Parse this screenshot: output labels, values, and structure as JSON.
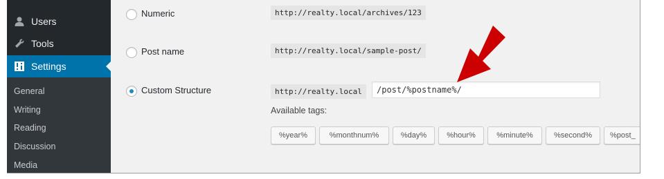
{
  "sidebar": {
    "items": [
      {
        "label": "Users",
        "icon": "user-icon"
      },
      {
        "label": "Tools",
        "icon": "wrench-icon"
      },
      {
        "label": "Settings",
        "icon": "settings-icon",
        "current": true
      }
    ],
    "submenu": [
      "General",
      "Writing",
      "Reading",
      "Discussion",
      "Media"
    ]
  },
  "permalinks": {
    "options": [
      {
        "label": "Numeric",
        "example": "http://realty.local/archives/123",
        "checked": false
      },
      {
        "label": "Post name",
        "example": "http://realty.local/sample-post/",
        "checked": false
      },
      {
        "label": "Custom Structure",
        "example": "http://realty.local",
        "checked": true
      }
    ],
    "custom_structure_value": "/post/%postname%/",
    "available_tags_label": "Available tags:",
    "tags": [
      "%year%",
      "%monthnum%",
      "%day%",
      "%hour%",
      "%minute%",
      "%second%",
      "%post_"
    ]
  },
  "colors": {
    "sidebar_bg": "#23282d",
    "submenu_bg": "#32373c",
    "accent": "#0073aa",
    "annotation_arrow": "#cc0000"
  }
}
